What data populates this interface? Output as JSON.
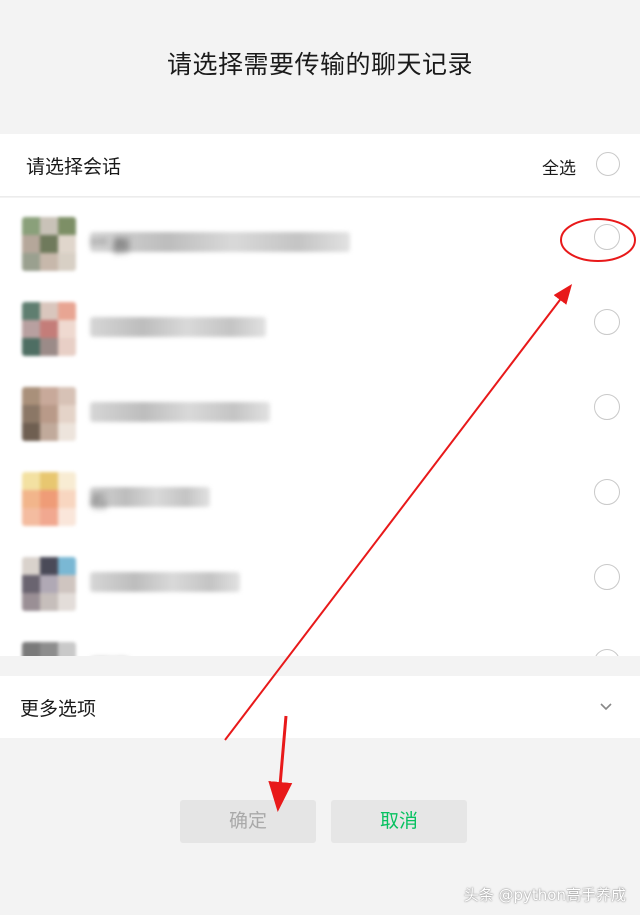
{
  "dialog": {
    "title": "请选择需要传输的聊天记录"
  },
  "header": {
    "label": "请选择会话",
    "select_all_label": "全选"
  },
  "conversations": [
    {
      "name": "“” 群",
      "avatar_colors": [
        "#8aa07a",
        "#c9c2b8",
        "#7d8f66",
        "#b5a79a",
        "#6f7a5c",
        "#e0d6cc",
        "#9aa08f",
        "#c7b8ab",
        "#d8d0c5"
      ],
      "checked": false,
      "annotated": true
    },
    {
      "name": "",
      "avatar_colors": [
        "#5f7e70",
        "#d9c6bd",
        "#e8a593",
        "#b8a0a0",
        "#c47d79",
        "#efd9d0",
        "#4e6e63",
        "#9b8b88",
        "#e8cfc6"
      ],
      "checked": false,
      "annotated": false
    },
    {
      "name": "",
      "avatar_colors": [
        "#a9907a",
        "#c8a99a",
        "#d7c2b6",
        "#8b7766",
        "#b99a89",
        "#e4d3c8",
        "#6f5f51",
        "#c1aa9b",
        "#ede4dc"
      ],
      "checked": false,
      "annotated": false
    },
    {
      "name": "石",
      "avatar_colors": [
        "#f3e1a2",
        "#e8c770",
        "#f8ecd3",
        "#f2b58b",
        "#ef9c77",
        "#f8d6c0",
        "#f4bca0",
        "#f1a890",
        "#fae6da"
      ],
      "checked": false,
      "annotated": false
    },
    {
      "name": "",
      "avatar_colors": [
        "#d9d2cc",
        "#4a4a58",
        "#7ab8d4",
        "#6a6470",
        "#b0a9b5",
        "#cfc5c0",
        "#9a8f95",
        "#c6bebb",
        "#e3ddd9"
      ],
      "checked": false,
      "annotated": false
    },
    {
      "name": "",
      "avatar_colors": [
        "#7a7a7a",
        "#8d8d8d",
        "#c9c9c9",
        "#b0b0b0",
        "#9c9c9c",
        "#e0e0e0",
        "#d0d0d0",
        "#bcbcbc",
        "#eeeeee"
      ],
      "checked": false,
      "annotated": false
    }
  ],
  "more": {
    "label": "更多选项"
  },
  "buttons": {
    "confirm": "确定",
    "cancel": "取消"
  },
  "watermark": "头条 @python高手养成",
  "colors": {
    "accent_green": "#07c160",
    "annotation_red": "#e8191a"
  }
}
